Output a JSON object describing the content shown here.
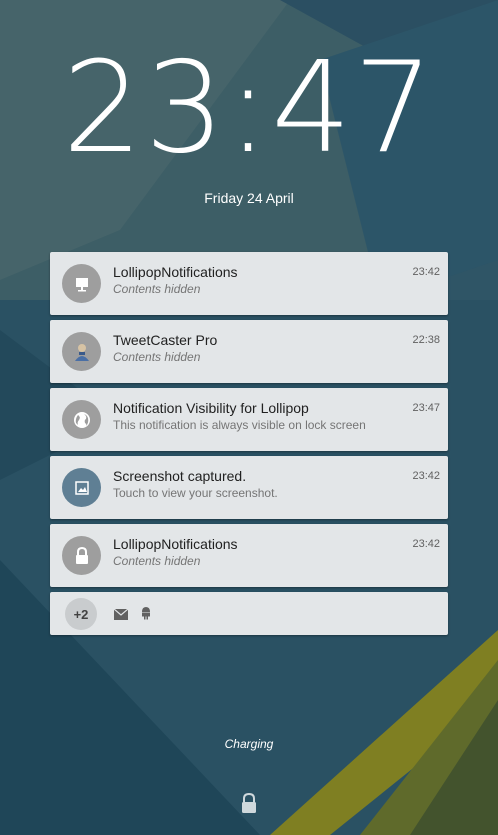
{
  "lockscreen": {
    "time": "23:47",
    "date": "Friday 24 April",
    "status": "Charging"
  },
  "notifications": [
    {
      "icon": "presentation-icon",
      "title": "LollipopNotifications",
      "text": "Contents hidden",
      "time": "23:42"
    },
    {
      "icon": "user-avatar-icon",
      "title": "TweetCaster Pro",
      "text": "Contents hidden",
      "time": "22:38"
    },
    {
      "icon": "globe-icon",
      "title": "Notification Visibility for Lollipop",
      "text": "This notification is always visible on lock screen",
      "time": "23:47"
    },
    {
      "icon": "image-icon",
      "title": "Screenshot captured.",
      "text": "Touch to view your screenshot.",
      "time": "23:42"
    },
    {
      "icon": "lock-icon",
      "title": "LollipopNotifications",
      "text": "Contents hidden",
      "time": "23:42"
    }
  ],
  "overflow": {
    "count_label": "+2",
    "icons": [
      "mail-icon",
      "android-icon"
    ]
  },
  "colors": {
    "card_bg": "#e3e6e8",
    "avatar_gray": "#9e9e9e",
    "avatar_blue": "#5f7f94",
    "wallpaper_base": "#2f5566",
    "accent_yellow": "#8e8e1e"
  }
}
